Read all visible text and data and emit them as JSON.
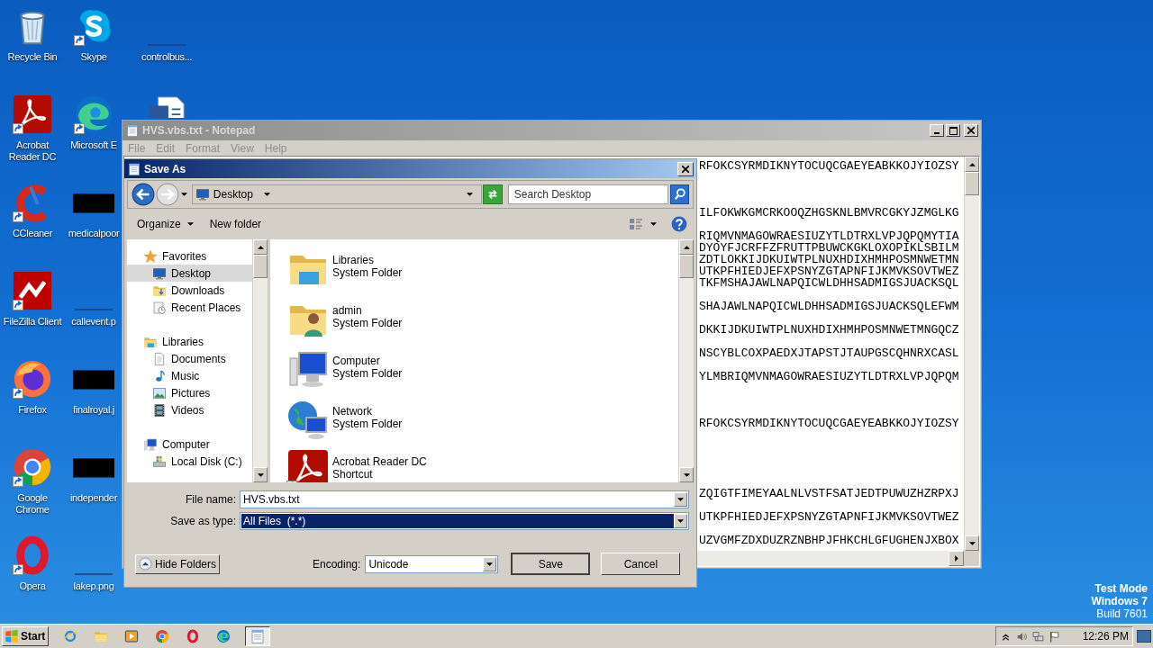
{
  "desktop_icons": [
    {
      "label": "Recycle Bin",
      "kind": "recycle-bin",
      "shortcut": false
    },
    {
      "label": "Acrobat Reader DC",
      "kind": "acrobat",
      "shortcut": true
    },
    {
      "label": "CCleaner",
      "kind": "ccleaner",
      "shortcut": true
    },
    {
      "label": "FileZilla Client",
      "kind": "filezilla",
      "shortcut": true
    },
    {
      "label": "Firefox",
      "kind": "firefox",
      "shortcut": true
    },
    {
      "label": "Google Chrome",
      "kind": "chrome",
      "shortcut": true
    },
    {
      "label": "Opera",
      "kind": "opera",
      "shortcut": true
    },
    {
      "label": "Skype",
      "kind": "skype",
      "shortcut": true
    },
    {
      "label": "Microsoft E",
      "kind": "edge",
      "shortcut": true
    },
    {
      "label": "medicalpoor",
      "kind": "file",
      "shortcut": false
    },
    {
      "label": "callevent.p",
      "kind": "blank",
      "shortcut": false
    },
    {
      "label": "finalroyal.j",
      "kind": "file",
      "shortcut": false
    },
    {
      "label": "independer",
      "kind": "file",
      "shortcut": false
    },
    {
      "label": "lakep.png",
      "kind": "blank",
      "shortcut": false
    },
    {
      "label": "controlbus...",
      "kind": "blank",
      "shortcut": false
    },
    {
      "kind": "word",
      "shortcut": false
    }
  ],
  "notepad": {
    "title": "HVS.vbs.txt - Notepad",
    "active": false,
    "menu": [
      {
        "label": "File",
        "disabled": true
      },
      {
        "label": "Edit",
        "disabled": true
      },
      {
        "label": "Format",
        "disabled": true
      },
      {
        "label": "View",
        "disabled": true
      },
      {
        "label": "Help",
        "disabled": true
      }
    ],
    "lines": [
      {
        "kind": "text",
        "text": "RFOKCSYRMDIKNYTOCUQCGAEYEABKKOJYIOZSY"
      },
      {
        "kind": "blank"
      },
      {
        "kind": "blank"
      },
      {
        "kind": "blank"
      },
      {
        "kind": "text",
        "text": "ILFOKWKGMCRKOOQZHGSKNLBMVRCGKYJZMGLKG"
      },
      {
        "kind": "blank"
      },
      {
        "kind": "text",
        "text": "RIQMVNMAGOWRAESIUZYTLDTRXLVPJQPQMYTIA"
      },
      {
        "kind": "text",
        "text": "DYOYFJCRFFZFRUTTPBUWCKGKLOXOPIKLSBILM"
      },
      {
        "kind": "text",
        "text": "ZDTLOKKIJDKUIWTPLNUXHDIXHMHPOSMNWETMN"
      },
      {
        "kind": "text",
        "text": "UTKPFHIEDJEFXPSNYZGTAPNFIJKMVKSOVTWEZ"
      },
      {
        "kind": "text",
        "text": "TKFMSHAJAWLNAPQICWLDHHSADMIGSJUACKSQL"
      },
      {
        "kind": "blank"
      },
      {
        "kind": "text",
        "text": "SHAJAWLNAPQICWLDHHSADMIGSJUACKSQLEFWM"
      },
      {
        "kind": "blank"
      },
      {
        "kind": "text",
        "text": "DKKIJDKUIWTPLNUXHDIXHMHPOSMNWETMNGQCZ"
      },
      {
        "kind": "blank"
      },
      {
        "kind": "text",
        "text": "NSCYBLCOXPAEDXJTAPSTJTAUPGSCQHNRXCASL"
      },
      {
        "kind": "blank"
      },
      {
        "kind": "text",
        "text": "YLMBRIQMVNMAGOWRAESIUZYTLDTRXLVPJQPQM"
      },
      {
        "kind": "blank"
      },
      {
        "kind": "blank"
      },
      {
        "kind": "blank"
      },
      {
        "kind": "text",
        "text": "RFOKCSYRMDIKNYTOCUQCGAEYEABKKOJYIOZSY"
      },
      {
        "kind": "blank"
      },
      {
        "kind": "blank"
      },
      {
        "kind": "blank"
      },
      {
        "kind": "blank"
      },
      {
        "kind": "blank"
      },
      {
        "kind": "text",
        "text": "ZQIGTFIMEYAALNLVSTFSATJEDTPUWUZHZRPXJ"
      },
      {
        "kind": "blank"
      },
      {
        "kind": "text",
        "text": "UTKPFHIEDJEFXPSNYZGTAPNFIJKMVKSOVTWEZ"
      },
      {
        "kind": "blank"
      },
      {
        "kind": "text",
        "text": "UZVGMFZDXDUZRZNBHPJFHKCHLGFUGHENJXBOX"
      }
    ]
  },
  "save_dialog": {
    "title": "Save As",
    "active": true,
    "address": "Desktop",
    "search": {
      "placeholder": "Search Desktop"
    },
    "toolbar": {
      "organize": "Organize",
      "new_folder": "New folder"
    },
    "nav_tree": [
      {
        "label": "Favorites",
        "kind": "star",
        "selected": false,
        "children": [
          {
            "label": "Desktop",
            "kind": "monitor",
            "selected": true
          },
          {
            "label": "Downloads",
            "kind": "download",
            "selected": false
          },
          {
            "label": "Recent Places",
            "kind": "recent",
            "selected": false
          }
        ]
      },
      {
        "label": "Libraries",
        "kind": "library",
        "selected": false,
        "children": [
          {
            "label": "Documents",
            "kind": "document",
            "selected": false
          },
          {
            "label": "Music",
            "kind": "music",
            "selected": false
          },
          {
            "label": "Pictures",
            "kind": "picture",
            "selected": false
          },
          {
            "label": "Videos",
            "kind": "film",
            "selected": false
          }
        ]
      },
      {
        "label": "Computer",
        "kind": "computer",
        "selected": false,
        "children": [
          {
            "label": "Local Disk (C:)",
            "kind": "drive",
            "selected": false
          }
        ]
      }
    ],
    "items": [
      {
        "name": "Libraries",
        "type": "System Folder",
        "kind": "library",
        "shortcut": false
      },
      {
        "name": "admin",
        "type": "System Folder",
        "kind": "user-folder",
        "shortcut": false
      },
      {
        "name": "Computer",
        "type": "System Folder",
        "kind": "computer",
        "shortcut": false
      },
      {
        "name": "Network",
        "type": "System Folder",
        "kind": "network",
        "shortcut": false
      },
      {
        "name": "Acrobat Reader DC",
        "type": "Shortcut",
        "kind": "acrobat",
        "shortcut": true
      }
    ],
    "file_name": {
      "label": "File name:",
      "value": "HVS.vbs.txt",
      "focused": false
    },
    "save_as_type": {
      "label": "Save as type:",
      "value": "All Files  (*.*)",
      "focused": true
    },
    "hide_folders": "Hide Folders",
    "encoding": {
      "label": "Encoding:",
      "value": "Unicode"
    },
    "buttons": [
      {
        "label": "Save",
        "default": true
      },
      {
        "label": "Cancel",
        "default": false
      }
    ]
  },
  "taskbar": {
    "start": "Start",
    "quick_launch": [
      {
        "kind": "ie"
      },
      {
        "kind": "explorer"
      },
      {
        "kind": "media"
      },
      {
        "kind": "chrome"
      },
      {
        "kind": "opera"
      },
      {
        "kind": "edge"
      }
    ],
    "tasks": [
      {
        "kind": "notepad",
        "selected": true
      }
    ],
    "tray": [
      {
        "kind": "chevron"
      },
      {
        "kind": "speaker"
      },
      {
        "kind": "network-tray"
      },
      {
        "kind": "flag"
      }
    ],
    "clock": "12:26 PM"
  },
  "os_notice": [
    "Test Mode",
    "Windows 7",
    "Build 7601"
  ]
}
